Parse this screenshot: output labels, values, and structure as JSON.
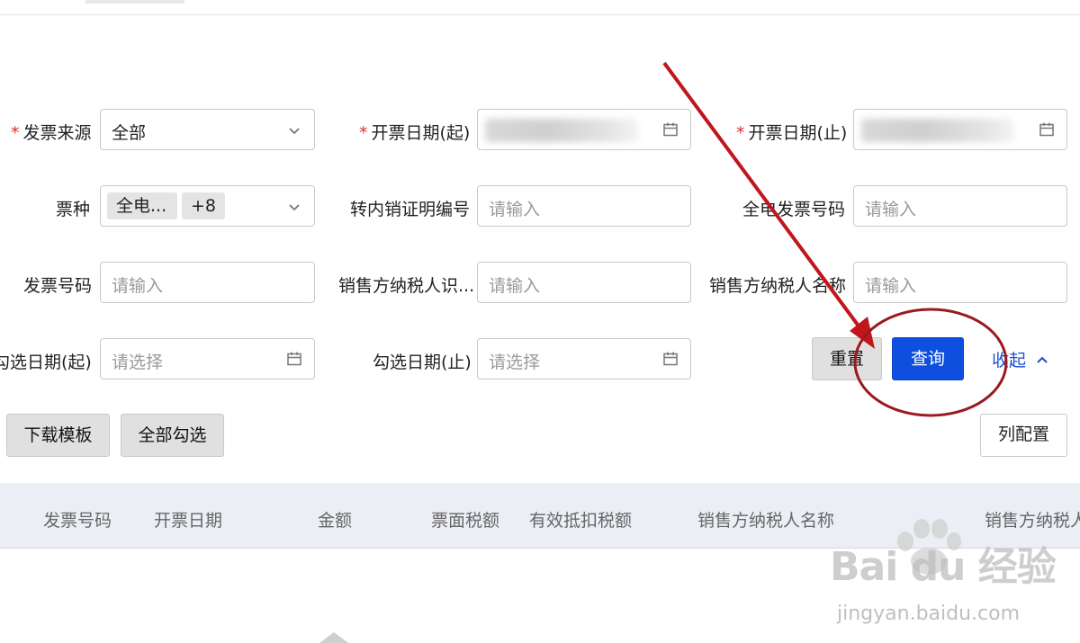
{
  "filters": {
    "invoice_source": {
      "label": "发票来源",
      "value": "全部"
    },
    "issue_date_start": {
      "label": "开票日期(起)"
    },
    "issue_date_end": {
      "label": "开票日期(止)"
    },
    "ticket_type": {
      "label": "票种",
      "tag1": "全电...",
      "tag2": "+8"
    },
    "transfer_cert_no": {
      "label": "转内销证明编号",
      "placeholder": "请输入"
    },
    "full_elec_invoice_no": {
      "label": "全电发票号码",
      "placeholder": "请输入"
    },
    "invoice_no": {
      "label": "发票号码",
      "placeholder": "请输入"
    },
    "seller_tax_id": {
      "label": "销售方纳税人识...",
      "placeholder": "请输入"
    },
    "seller_tax_name": {
      "label": "销售方纳税人名称",
      "placeholder": "请输入"
    },
    "check_date_start": {
      "label": "勾选日期(起)",
      "placeholder": "请选择"
    },
    "check_date_end": {
      "label": "勾选日期(止)",
      "placeholder": "请选择"
    }
  },
  "actions": {
    "reset": "重置",
    "query": "查询",
    "collapse": "收起",
    "download_template": "下载模板",
    "select_all": "全部勾选",
    "column_config": "列配置"
  },
  "table": {
    "headers": [
      "发票号码",
      "开票日期",
      "金额",
      "票面税额",
      "有效抵扣税额",
      "销售方纳税人名称",
      "销售方纳税人"
    ]
  },
  "watermark": {
    "main": "Bai du 经验",
    "sub": "jingyan.baidu.com"
  },
  "colors": {
    "primary": "#0f4fe0",
    "required": "#d6332f",
    "annotation": "#c0161c"
  },
  "icons": [
    "chevron-down-icon",
    "calendar-icon",
    "chevron-up-icon",
    "arrow-annotation",
    "circle-annotation"
  ]
}
